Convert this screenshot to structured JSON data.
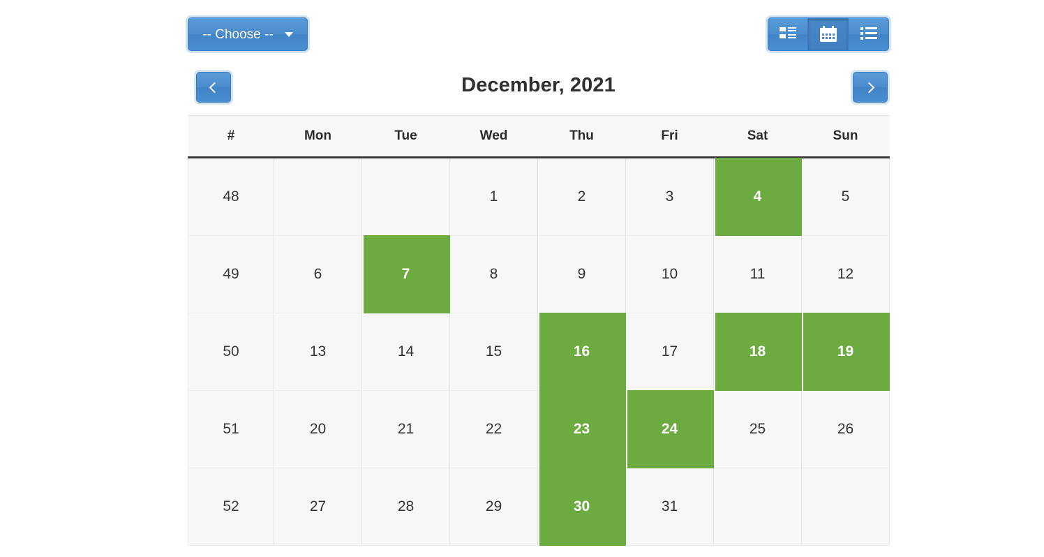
{
  "theme": {
    "accent_blue": "#4a8fd2",
    "highlight_green": "#6cab3f",
    "cell_background": "#f7f7f7",
    "text_color": "#333333"
  },
  "toolbar": {
    "choose_label": "-- Choose --",
    "caret_icon": "chevron-down-icon",
    "view_buttons": [
      {
        "name": "th-list-icon",
        "title": "List view",
        "active": false
      },
      {
        "name": "calendar-icon",
        "title": "Calendar view",
        "active": true
      },
      {
        "name": "list-ul-icon",
        "title": "Agenda view",
        "active": false
      }
    ]
  },
  "calendar": {
    "title": "December, 2021",
    "prev_icon": "chevron-left-icon",
    "next_icon": "chevron-right-icon",
    "columns": [
      "#",
      "Mon",
      "Tue",
      "Wed",
      "Thu",
      "Fri",
      "Sat",
      "Sun"
    ],
    "weeks": [
      {
        "week": "48",
        "days": [
          {
            "label": "",
            "highlight": false
          },
          {
            "label": "",
            "highlight": false
          },
          {
            "label": "1",
            "highlight": false
          },
          {
            "label": "2",
            "highlight": false
          },
          {
            "label": "3",
            "highlight": false
          },
          {
            "label": "4",
            "highlight": true
          },
          {
            "label": "5",
            "highlight": false
          }
        ]
      },
      {
        "week": "49",
        "days": [
          {
            "label": "6",
            "highlight": false
          },
          {
            "label": "7",
            "highlight": true
          },
          {
            "label": "8",
            "highlight": false
          },
          {
            "label": "9",
            "highlight": false
          },
          {
            "label": "10",
            "highlight": false
          },
          {
            "label": "11",
            "highlight": false
          },
          {
            "label": "12",
            "highlight": false
          }
        ]
      },
      {
        "week": "50",
        "days": [
          {
            "label": "13",
            "highlight": false
          },
          {
            "label": "14",
            "highlight": false
          },
          {
            "label": "15",
            "highlight": false
          },
          {
            "label": "16",
            "highlight": true
          },
          {
            "label": "17",
            "highlight": false
          },
          {
            "label": "18",
            "highlight": true
          },
          {
            "label": "19",
            "highlight": true
          }
        ]
      },
      {
        "week": "51",
        "days": [
          {
            "label": "20",
            "highlight": false
          },
          {
            "label": "21",
            "highlight": false
          },
          {
            "label": "22",
            "highlight": false
          },
          {
            "label": "23",
            "highlight": true
          },
          {
            "label": "24",
            "highlight": true
          },
          {
            "label": "25",
            "highlight": false
          },
          {
            "label": "26",
            "highlight": false
          }
        ]
      },
      {
        "week": "52",
        "days": [
          {
            "label": "27",
            "highlight": false
          },
          {
            "label": "28",
            "highlight": false
          },
          {
            "label": "29",
            "highlight": false
          },
          {
            "label": "30",
            "highlight": true
          },
          {
            "label": "31",
            "highlight": false
          },
          {
            "label": "",
            "highlight": false
          },
          {
            "label": "",
            "highlight": false
          }
        ]
      }
    ]
  }
}
